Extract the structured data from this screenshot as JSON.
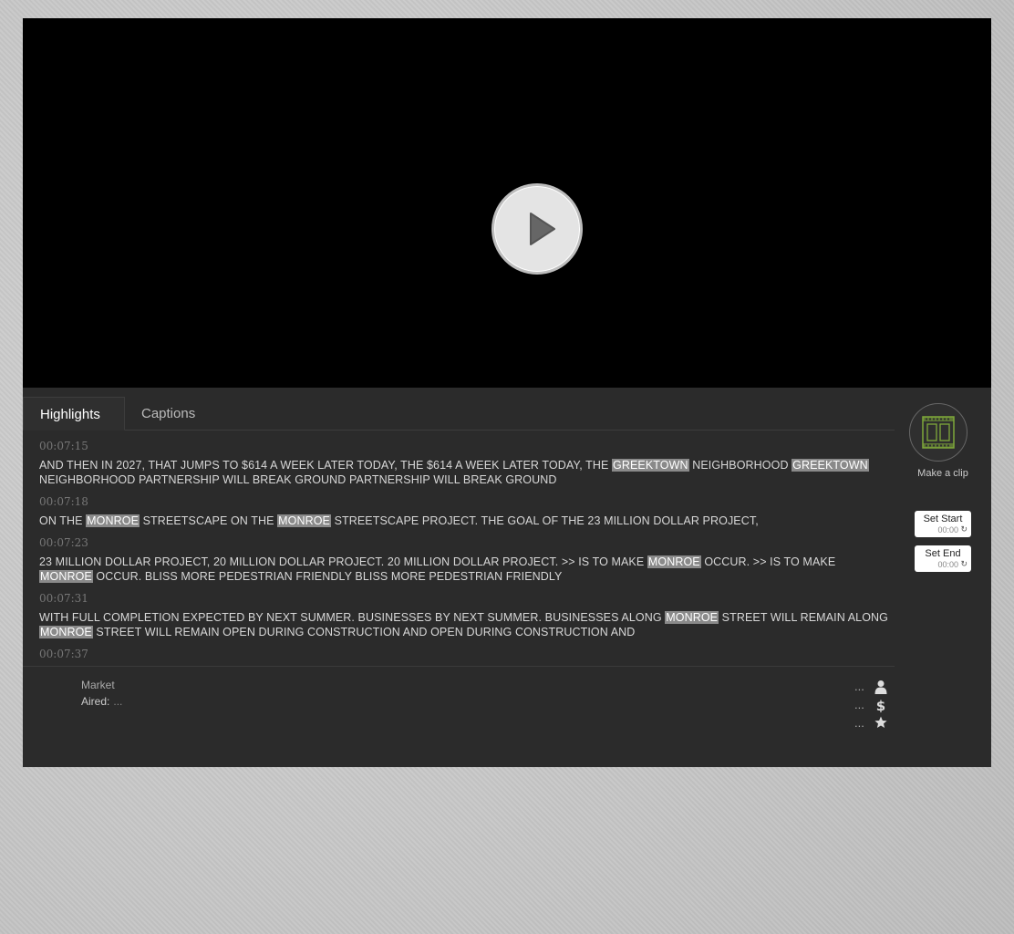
{
  "tabs": [
    {
      "label": "Highlights",
      "active": true
    },
    {
      "label": "Captions",
      "active": false
    }
  ],
  "transcript": [
    {
      "time": "00:07:15",
      "segments": [
        {
          "t": "AND THEN IN 2027, THAT JUMPS TO $614 A WEEK LATER TODAY, THE $614 A WEEK LATER TODAY, THE "
        },
        {
          "t": "GREEKTOWN",
          "hl": true
        },
        {
          "t": " NEIGHBORHOOD "
        },
        {
          "t": "GREEKTOWN",
          "hl": true
        },
        {
          "t": " NEIGHBORHOOD PARTNERSHIP WILL BREAK GROUND PARTNERSHIP WILL BREAK GROUND"
        }
      ]
    },
    {
      "time": "00:07:18",
      "segments": [
        {
          "t": "ON THE "
        },
        {
          "t": "MONROE",
          "hl": true
        },
        {
          "t": " STREETSCAPE ON THE "
        },
        {
          "t": "MONROE",
          "hl": true
        },
        {
          "t": " STREETSCAPE PROJECT. THE GOAL OF THE 23 MILLION DOLLAR PROJECT,"
        }
      ]
    },
    {
      "time": "00:07:23",
      "segments": [
        {
          "t": "23 MILLION DOLLAR PROJECT, 20 MILLION DOLLAR PROJECT. 20 MILLION DOLLAR PROJECT. >> IS TO MAKE "
        },
        {
          "t": "MONROE",
          "hl": true
        },
        {
          "t": " OCCUR. >> IS TO MAKE "
        },
        {
          "t": "MONROE",
          "hl": true
        },
        {
          "t": " OCCUR. BLISS MORE PEDESTRIAN FRIENDLY BLISS MORE PEDESTRIAN FRIENDLY"
        }
      ]
    },
    {
      "time": "00:07:31",
      "segments": [
        {
          "t": "WITH FULL COMPLETION EXPECTED BY NEXT SUMMER. BUSINESSES BY NEXT SUMMER. BUSINESSES ALONG "
        },
        {
          "t": "MONROE",
          "hl": true
        },
        {
          "t": " STREET WILL REMAIN ALONG "
        },
        {
          "t": "MONROE",
          "hl": true
        },
        {
          "t": " STREET WILL REMAIN OPEN DURING CONSTRUCTION AND OPEN DURING CONSTRUCTION AND"
        }
      ]
    },
    {
      "time": "00:07:37",
      "segments": []
    }
  ],
  "info": {
    "market_label": "Market",
    "aired_label": "Aired:",
    "aired_value": "...",
    "rows": [
      {
        "value": "...",
        "icon": "person-icon"
      },
      {
        "value": "...",
        "icon": "dollar-icon"
      },
      {
        "value": "...",
        "icon": "star-icon"
      }
    ]
  },
  "side": {
    "clip_label": "Make a clip",
    "set_start_label": "Set Start",
    "set_start_time": "00:00",
    "set_end_label": "Set End",
    "set_end_time": "00:00",
    "refresh_glyph": "↻"
  },
  "colors": {
    "accent_green": "#7fa83a",
    "highlight_bg": "#8a8a8a"
  }
}
